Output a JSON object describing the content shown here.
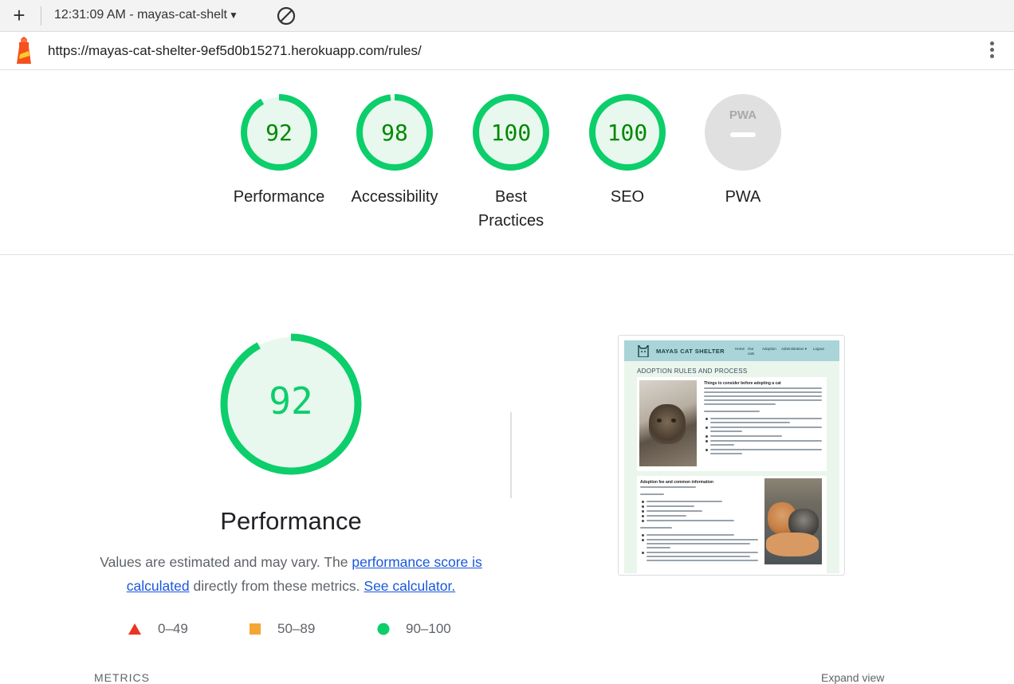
{
  "toolbar": {
    "new_tab_icon": "plus-icon",
    "report_title": "12:31:09 AM - mayas-cat-shelt",
    "dropdown_icon": "caret-down-icon",
    "clear_icon": "block-icon"
  },
  "urlbar": {
    "url": "https://mayas-cat-shelter-9ef5d0b15271.herokuapp.com/rules/",
    "logo_icon": "lighthouse-icon",
    "menu_icon": "more-vert-icon"
  },
  "gauges": [
    {
      "label": "Performance",
      "score": "92",
      "value": 92
    },
    {
      "label": "Accessibility",
      "score": "98",
      "value": 98
    },
    {
      "label": "Best Practices",
      "score": "100",
      "value": 100
    },
    {
      "label": "SEO",
      "score": "100",
      "value": 100
    },
    {
      "label": "PWA",
      "score": "",
      "value": null,
      "badge": "PWA"
    }
  ],
  "performance": {
    "score": "92",
    "value": 92,
    "title": "Performance",
    "desc_prefix": "Values are estimated and may vary. The ",
    "link_score": "performance score is calculated",
    "desc_middle": " directly from these metrics. ",
    "link_calc": "See calculator."
  },
  "legend": [
    {
      "range": "0–49",
      "shape": "triangle",
      "color": "#eb3323"
    },
    {
      "range": "50–89",
      "shape": "square",
      "color": "#f4a536"
    },
    {
      "range": "90–100",
      "shape": "circle",
      "color": "#0cce6b"
    }
  ],
  "colors": {
    "pass": "#0cce6b",
    "pass_text": "#008800",
    "pass_bg": "#e8f8ee",
    "na_bg": "#e0e0e0"
  },
  "thumbnail": {
    "brand": "MAYAS CAT SHELTER",
    "nav": [
      "Home",
      "Our cats",
      "Adoption",
      "Administration ▾",
      "Logout"
    ],
    "heading": "ADOPTION RULES AND PROCESS",
    "card1_title": "Things to consider before adopting a cat",
    "card2_title": "Adoption fee and common information"
  },
  "peek": {
    "metrics": "METRICS",
    "expand": "Expand view"
  }
}
